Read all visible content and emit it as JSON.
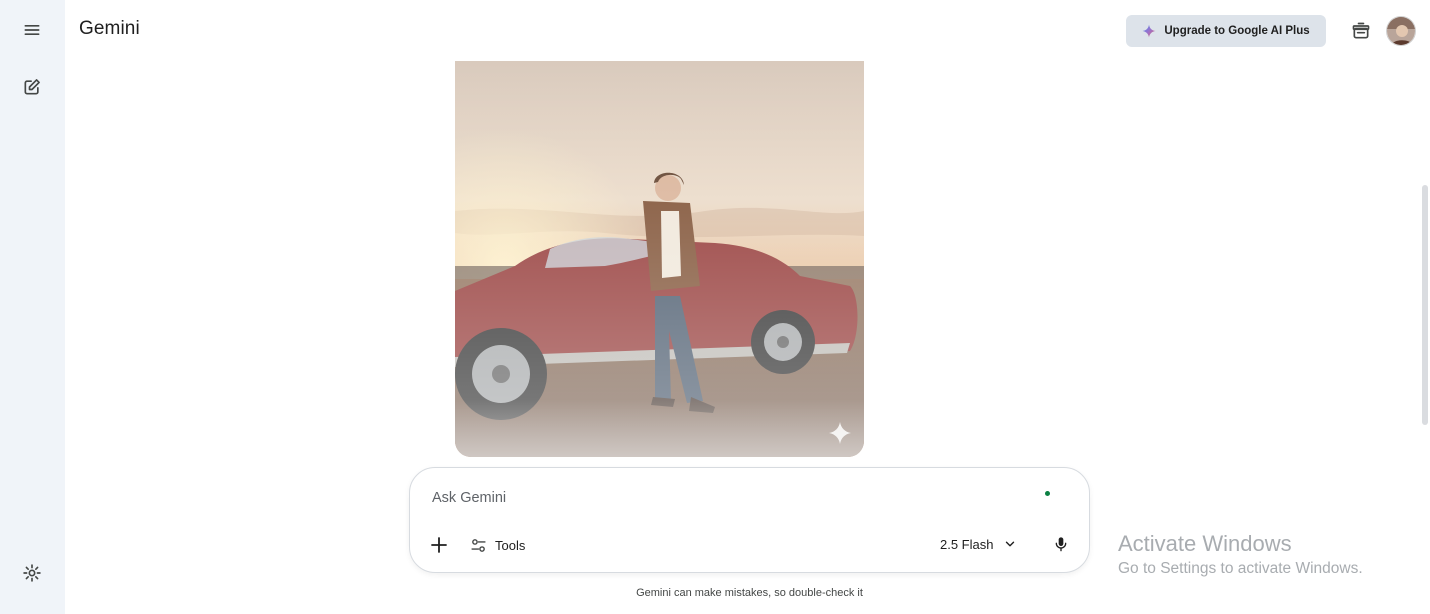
{
  "app": {
    "title": "Gemini"
  },
  "header": {
    "upgrade_label": "Upgrade to Google AI Plus"
  },
  "sidebar": {
    "icons": [
      "menu-icon",
      "new-chat-icon",
      "settings-icon"
    ]
  },
  "composer": {
    "placeholder": "Ask Gemini",
    "tools_label": "Tools",
    "model_label": "2.5 Flash"
  },
  "footer": {
    "disclaimer": "Gemini can make mistakes, so double-check it"
  },
  "watermark": {
    "title": "Activate Windows",
    "subtitle": "Go to Settings to activate Windows."
  },
  "colors": {
    "sidebar_bg": "#f0f4f9",
    "upgrade_bg": "#dde3ea",
    "status_dot": "#0b8043",
    "text": "#1f1f1f"
  }
}
